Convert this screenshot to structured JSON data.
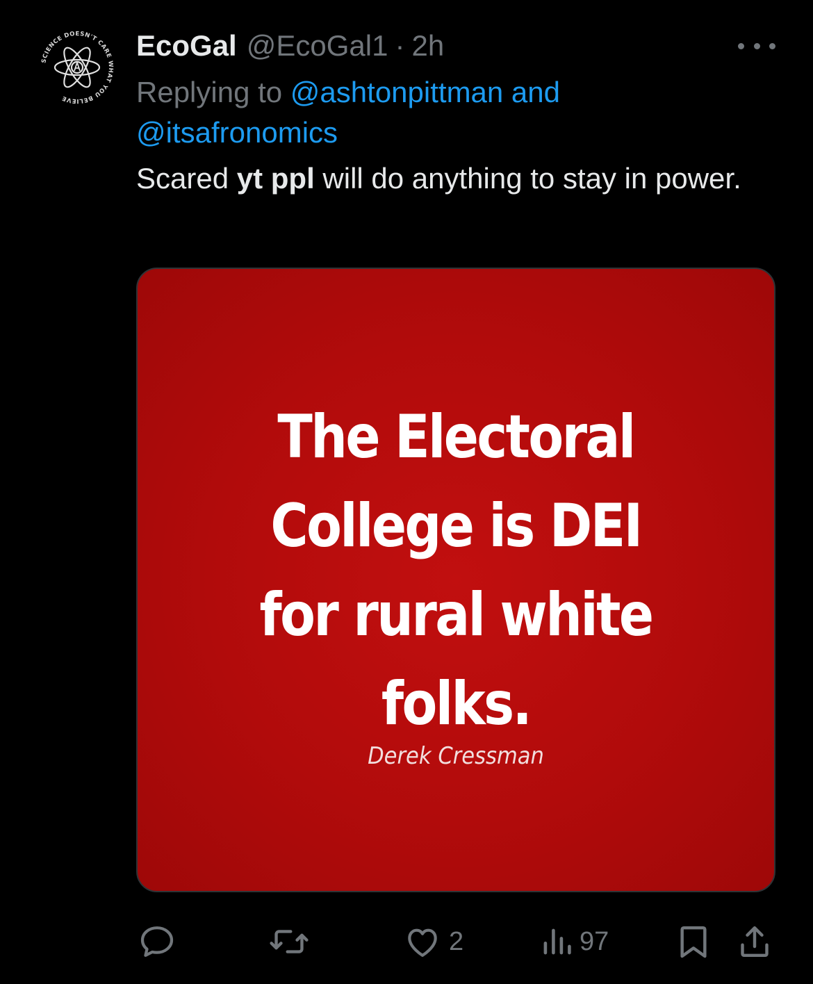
{
  "user": {
    "display_name": "EcoGal",
    "handle": "@EcoGal1",
    "separator": "·",
    "time": "2h",
    "avatar_ring_text": "SCIENCE DOESN'T CARE WHAT YOU BELIEVE"
  },
  "reply": {
    "prefix": "Replying to ",
    "mention_1": "@ashtonpittman",
    "joiner": " and",
    "mention_2": "@itsafronomics"
  },
  "text": {
    "part_1": "Scared ",
    "bold": "yt ppl",
    "part_2": " will do anything to stay in power."
  },
  "media": {
    "quote_line_1": "The Electoral",
    "quote_line_2": "College is DEI",
    "quote_line_3": "for rural white",
    "quote_line_4": "folks.",
    "attribution": "Derek Cressman",
    "background_color": "#b80c0c"
  },
  "actions": {
    "reply_icon": "speech-bubble-icon",
    "retweet_icon": "retweet-icon",
    "like_icon": "heart-icon",
    "like_count": "2",
    "views_icon": "bar-chart-icon",
    "views_count": "97",
    "bookmark_icon": "bookmark-icon",
    "share_icon": "share-icon"
  },
  "colors": {
    "background": "#000000",
    "text": "#e7e9ea",
    "muted": "#71767b",
    "link": "#1d9bf0"
  }
}
